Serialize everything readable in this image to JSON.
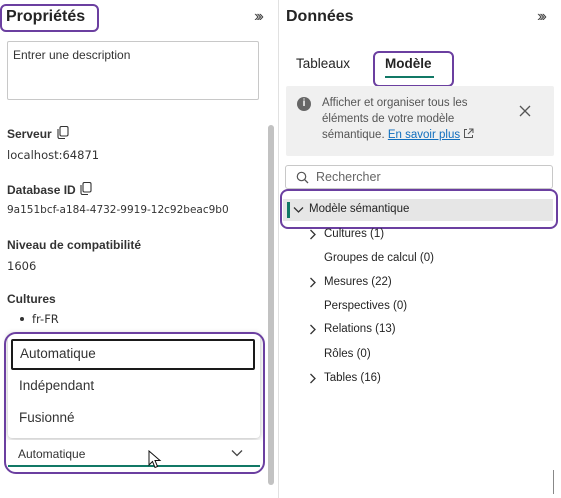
{
  "properties_pane": {
    "title": "Propriétés",
    "collapse_icon": "double-chevron-right-icon",
    "description_placeholder": "Entrer une description",
    "fields": [
      {
        "label": "Serveur",
        "value": "localhost:64871"
      },
      {
        "label": "Database ID",
        "value": "9a151bcf-a184-4732-9919-12c92beac9b0"
      },
      {
        "label": "Niveau de compatibilité",
        "value": "1606"
      },
      {
        "label": "Cultures",
        "value": "fr-FR"
      }
    ],
    "dropdown": {
      "options": [
        "Automatique",
        "Indépendant",
        "Fusionné"
      ],
      "selected": "Automatique"
    }
  },
  "data_pane": {
    "title": "Données",
    "collapse_icon": "double-chevron-right-icon",
    "tabs": [
      {
        "label": "Tableaux",
        "active": false
      },
      {
        "label": "Modèle",
        "active": true
      }
    ],
    "info_banner": {
      "text": "Afficher et organiser tous les éléments de votre modèle sémantique.",
      "link": "En savoir plus"
    },
    "search_placeholder": "Rechercher",
    "tree": {
      "root": "Modèle sémantique",
      "items": [
        {
          "label": "Cultures (1)",
          "expandable": true
        },
        {
          "label": "Groupes de calcul (0)",
          "expandable": false
        },
        {
          "label": "Mesures (22)",
          "expandable": true
        },
        {
          "label": "Perspectives (0)",
          "expandable": false
        },
        {
          "label": "Relations (13)",
          "expandable": true
        },
        {
          "label": "Rôles (0)",
          "expandable": false
        },
        {
          "label": "Tables (16)",
          "expandable": true
        }
      ]
    }
  },
  "colors": {
    "highlight": "#6b3fa0",
    "accent_green": "#117865",
    "link": "#106ebe"
  }
}
